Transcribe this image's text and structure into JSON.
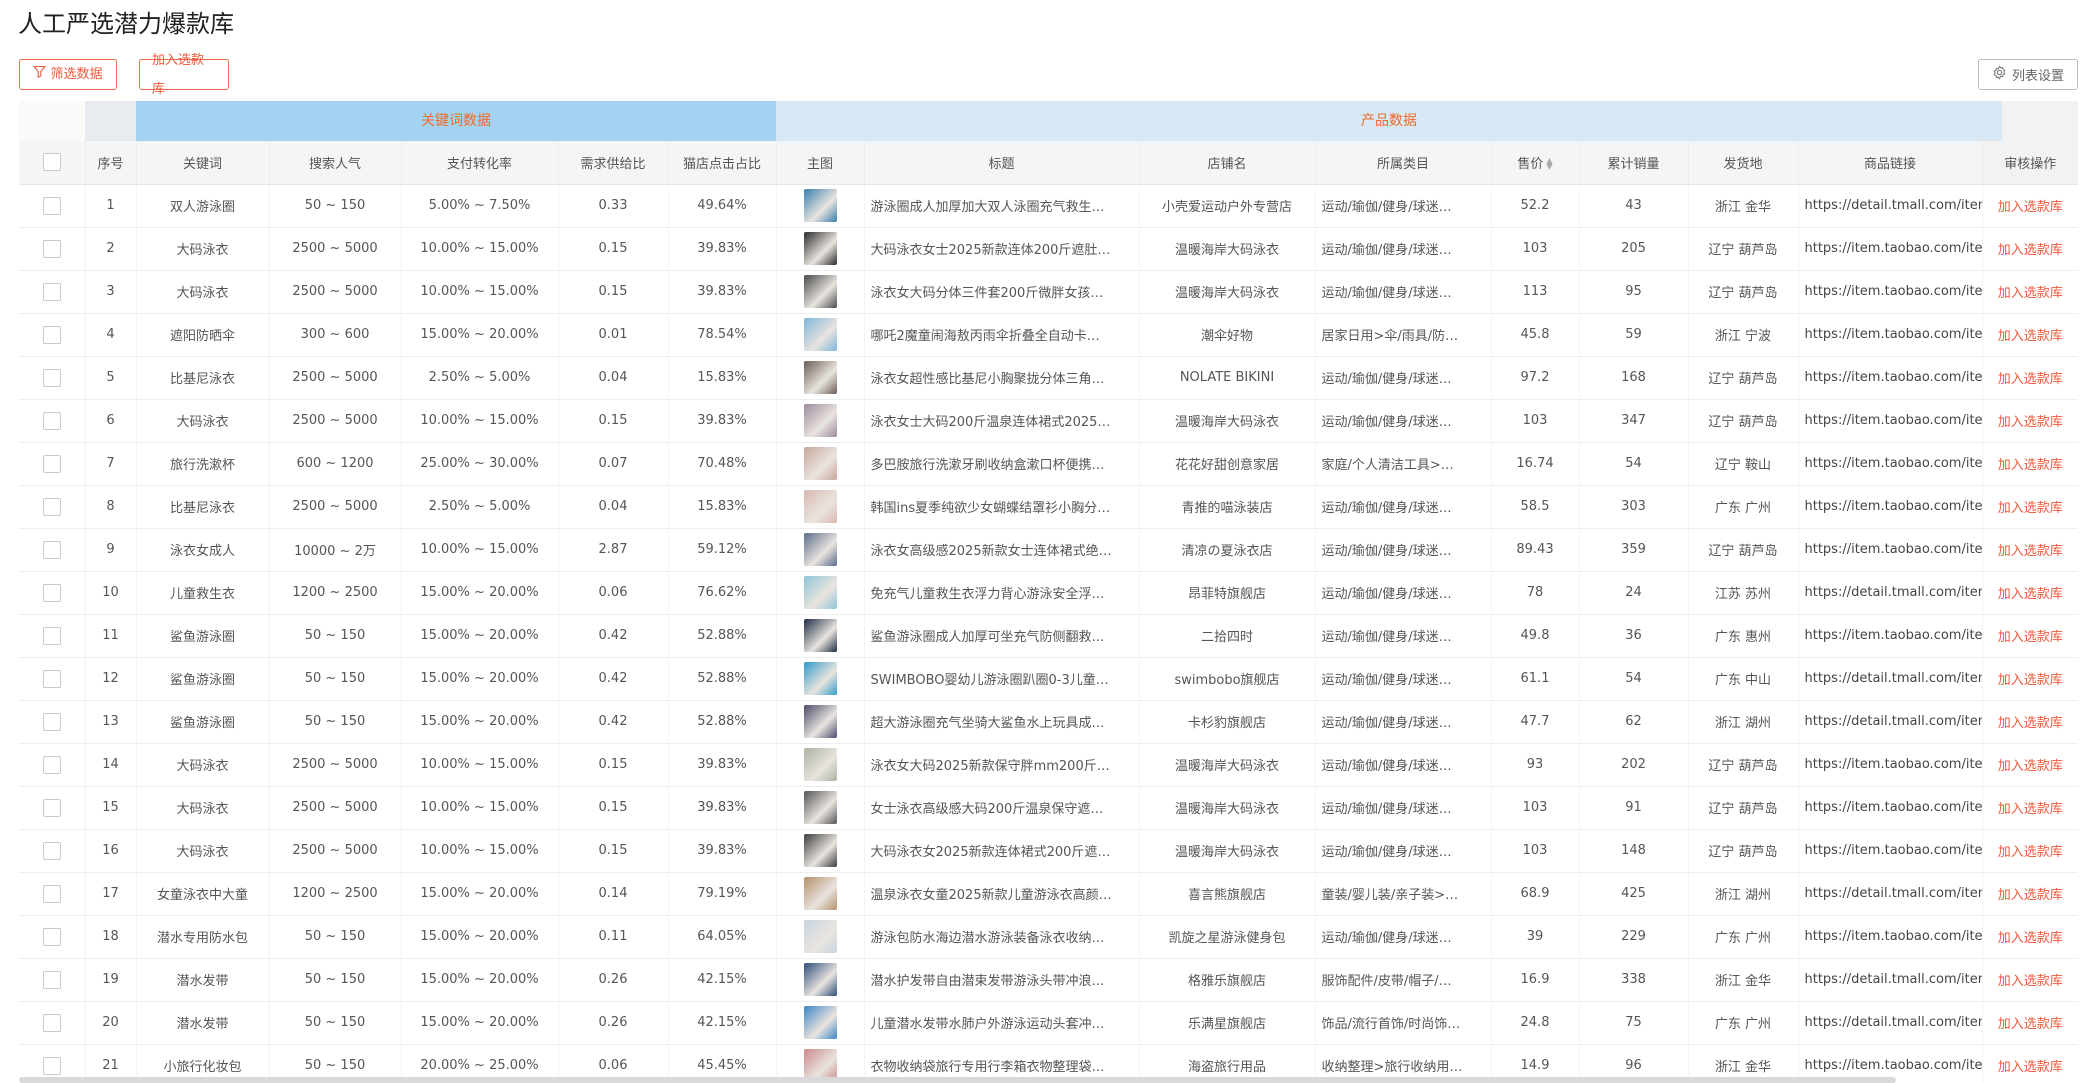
{
  "page": {
    "title": "人工严选潜力爆款库"
  },
  "toolbar": {
    "filter_label": "筛选数据",
    "add_label": "加入选款库",
    "columns_label": "列表设置"
  },
  "groups": {
    "keyword": "关键词数据",
    "product": "产品数据"
  },
  "columns": [
    "序号",
    "关键词",
    "搜索人气",
    "支付转化率",
    "需求供给比",
    "猫店点击占比",
    "主图",
    "标题",
    "店铺名",
    "所属类目",
    "售价",
    "累计销量",
    "发货地",
    "商品链接",
    "审核操作"
  ],
  "thumb_colors": [
    "#3a7fae",
    "#2a2a2a",
    "#4a4a4a",
    "#7cb6d9",
    "#6b5d55",
    "#9a8a9c",
    "#c7a69a",
    "#d9b8b0",
    "#5a6c8a",
    "#8fc4d8",
    "#1e2c44",
    "#2f9bc9",
    "#4a4a6a",
    "#a9b3a0",
    "#555555",
    "#3c3c3c",
    "#b5906a",
    "#c7d5e0",
    "#2b4d7a",
    "#3b84c4",
    "#c98a8a"
  ],
  "rows": [
    {
      "no": "1",
      "kw": "双人游泳圈",
      "pop": "50 ~ 150",
      "conv": "5.00% ~ 7.50%",
      "ratio": "0.33",
      "click": "49.64%",
      "title": "游泳圈成人加厚加大双人泳圈充气救生…",
      "shop": "小壳爱运动户外专营店",
      "cat": "运动/瑜伽/健身/球迷…",
      "price": "52.2",
      "sales": "43",
      "loc": "浙江 金华",
      "link": "https://detail.tmall.com/item.htm",
      "action": "加入选款库"
    },
    {
      "no": "2",
      "kw": "大码泳衣",
      "pop": "2500 ~ 5000",
      "conv": "10.00% ~ 15.00%",
      "ratio": "0.15",
      "click": "39.83%",
      "title": "大码泳衣女士2025新款连体200斤遮肚…",
      "shop": "温暖海岸大码泳衣",
      "cat": "运动/瑜伽/健身/球迷…",
      "price": "103",
      "sales": "205",
      "loc": "辽宁 葫芦岛",
      "link": "https://item.taobao.com/item.htm",
      "action": "加入选款库"
    },
    {
      "no": "3",
      "kw": "大码泳衣",
      "pop": "2500 ~ 5000",
      "conv": "10.00% ~ 15.00%",
      "ratio": "0.15",
      "click": "39.83%",
      "title": "泳衣女大码分体三件套200斤微胖女孩…",
      "shop": "温暖海岸大码泳衣",
      "cat": "运动/瑜伽/健身/球迷…",
      "price": "113",
      "sales": "95",
      "loc": "辽宁 葫芦岛",
      "link": "https://item.taobao.com/item.htm",
      "action": "加入选款库"
    },
    {
      "no": "4",
      "kw": "遮阳防晒伞",
      "pop": "300 ~ 600",
      "conv": "15.00% ~ 20.00%",
      "ratio": "0.01",
      "click": "78.54%",
      "title": "哪吒2魔童闹海敖丙雨伞折叠全自动卡…",
      "shop": "潮伞好物",
      "cat": "居家日用>伞/雨具/防…",
      "price": "45.8",
      "sales": "59",
      "loc": "浙江 宁波",
      "link": "https://item.taobao.com/item.htm",
      "action": "加入选款库"
    },
    {
      "no": "5",
      "kw": "比基尼泳衣",
      "pop": "2500 ~ 5000",
      "conv": "2.50% ~ 5.00%",
      "ratio": "0.04",
      "click": "15.83%",
      "title": "泳衣女超性感比基尼小胸聚拢分体三角…",
      "shop": "NOLATE BIKINI",
      "cat": "运动/瑜伽/健身/球迷…",
      "price": "97.2",
      "sales": "168",
      "loc": "辽宁 葫芦岛",
      "link": "https://item.taobao.com/item.htm",
      "action": "加入选款库"
    },
    {
      "no": "6",
      "kw": "大码泳衣",
      "pop": "2500 ~ 5000",
      "conv": "10.00% ~ 15.00%",
      "ratio": "0.15",
      "click": "39.83%",
      "title": "泳衣女士大码200斤温泉连体裙式2025…",
      "shop": "温暖海岸大码泳衣",
      "cat": "运动/瑜伽/健身/球迷…",
      "price": "103",
      "sales": "347",
      "loc": "辽宁 葫芦岛",
      "link": "https://item.taobao.com/item.htm",
      "action": "加入选款库"
    },
    {
      "no": "7",
      "kw": "旅行洗漱杯",
      "pop": "600 ~ 1200",
      "conv": "25.00% ~ 30.00%",
      "ratio": "0.07",
      "click": "70.48%",
      "title": "多巴胺旅行洗漱牙刷收纳盒漱口杯便携…",
      "shop": "花花好甜创意家居",
      "cat": "家庭/个人清洁工具>…",
      "price": "16.74",
      "sales": "54",
      "loc": "辽宁 鞍山",
      "link": "https://item.taobao.com/item.htm",
      "action": "加入选款库"
    },
    {
      "no": "8",
      "kw": "比基尼泳衣",
      "pop": "2500 ~ 5000",
      "conv": "2.50% ~ 5.00%",
      "ratio": "0.04",
      "click": "15.83%",
      "title": "韩国ins夏季纯欲少女蝴蝶结罩衫小胸分…",
      "shop": "青推的喵泳装店",
      "cat": "运动/瑜伽/健身/球迷…",
      "price": "58.5",
      "sales": "303",
      "loc": "广东 广州",
      "link": "https://item.taobao.com/item.htm",
      "action": "加入选款库"
    },
    {
      "no": "9",
      "kw": "泳衣女成人",
      "pop": "10000 ~ 2万",
      "conv": "10.00% ~ 15.00%",
      "ratio": "2.87",
      "click": "59.12%",
      "title": "泳衣女高级感2025新款女士连体裙式绝…",
      "shop": "清凉の夏泳衣店",
      "cat": "运动/瑜伽/健身/球迷…",
      "price": "89.43",
      "sales": "359",
      "loc": "辽宁 葫芦岛",
      "link": "https://item.taobao.com/item.htm",
      "action": "加入选款库"
    },
    {
      "no": "10",
      "kw": "儿童救生衣",
      "pop": "1200 ~ 2500",
      "conv": "15.00% ~ 20.00%",
      "ratio": "0.06",
      "click": "76.62%",
      "title": "免充气儿童救生衣浮力背心游泳安全浮…",
      "shop": "昂菲特旗舰店",
      "cat": "运动/瑜伽/健身/球迷…",
      "price": "78",
      "sales": "24",
      "loc": "江苏 苏州",
      "link": "https://detail.tmall.com/item.htm",
      "action": "加入选款库"
    },
    {
      "no": "11",
      "kw": "鲨鱼游泳圈",
      "pop": "50 ~ 150",
      "conv": "15.00% ~ 20.00%",
      "ratio": "0.42",
      "click": "52.88%",
      "title": "鲨鱼游泳圈成人加厚可坐充气防侧翻救…",
      "shop": "二拾四时",
      "cat": "运动/瑜伽/健身/球迷…",
      "price": "49.8",
      "sales": "36",
      "loc": "广东 惠州",
      "link": "https://item.taobao.com/item.htm",
      "action": "加入选款库"
    },
    {
      "no": "12",
      "kw": "鲨鱼游泳圈",
      "pop": "50 ~ 150",
      "conv": "15.00% ~ 20.00%",
      "ratio": "0.42",
      "click": "52.88%",
      "title": "SWIMBOBO婴幼儿游泳圈趴圈0-3儿童…",
      "shop": "swimbobo旗舰店",
      "cat": "运动/瑜伽/健身/球迷…",
      "price": "61.1",
      "sales": "54",
      "loc": "广东 中山",
      "link": "https://detail.tmall.com/item.htm",
      "action": "加入选款库"
    },
    {
      "no": "13",
      "kw": "鲨鱼游泳圈",
      "pop": "50 ~ 150",
      "conv": "15.00% ~ 20.00%",
      "ratio": "0.42",
      "click": "52.88%",
      "title": "超大游泳圈充气坐骑大鲨鱼水上玩具成…",
      "shop": "卡杉豹旗舰店",
      "cat": "运动/瑜伽/健身/球迷…",
      "price": "47.7",
      "sales": "62",
      "loc": "浙江 湖州",
      "link": "https://detail.tmall.com/item.htm",
      "action": "加入选款库"
    },
    {
      "no": "14",
      "kw": "大码泳衣",
      "pop": "2500 ~ 5000",
      "conv": "10.00% ~ 15.00%",
      "ratio": "0.15",
      "click": "39.83%",
      "title": "泳衣女大码2025新款保守胖mm200斤…",
      "shop": "温暖海岸大码泳衣",
      "cat": "运动/瑜伽/健身/球迷…",
      "price": "93",
      "sales": "202",
      "loc": "辽宁 葫芦岛",
      "link": "https://item.taobao.com/item.htm",
      "action": "加入选款库"
    },
    {
      "no": "15",
      "kw": "大码泳衣",
      "pop": "2500 ~ 5000",
      "conv": "10.00% ~ 15.00%",
      "ratio": "0.15",
      "click": "39.83%",
      "title": "女士泳衣高级感大码200斤温泉保守遮…",
      "shop": "温暖海岸大码泳衣",
      "cat": "运动/瑜伽/健身/球迷…",
      "price": "103",
      "sales": "91",
      "loc": "辽宁 葫芦岛",
      "link": "https://item.taobao.com/item.htm",
      "action": "加入选款库"
    },
    {
      "no": "16",
      "kw": "大码泳衣",
      "pop": "2500 ~ 5000",
      "conv": "10.00% ~ 15.00%",
      "ratio": "0.15",
      "click": "39.83%",
      "title": "大码泳衣女2025新款连体裙式200斤遮…",
      "shop": "温暖海岸大码泳衣",
      "cat": "运动/瑜伽/健身/球迷…",
      "price": "103",
      "sales": "148",
      "loc": "辽宁 葫芦岛",
      "link": "https://item.taobao.com/item.htm",
      "action": "加入选款库"
    },
    {
      "no": "17",
      "kw": "女童泳衣中大童",
      "pop": "1200 ~ 2500",
      "conv": "15.00% ~ 20.00%",
      "ratio": "0.14",
      "click": "79.19%",
      "title": "温泉泳衣女童2025新款儿童游泳衣高颜…",
      "shop": "喜言熊旗舰店",
      "cat": "童装/婴儿装/亲子装>…",
      "price": "68.9",
      "sales": "425",
      "loc": "浙江 湖州",
      "link": "https://detail.tmall.com/item.htm",
      "action": "加入选款库"
    },
    {
      "no": "18",
      "kw": "潜水专用防水包",
      "pop": "50 ~ 150",
      "conv": "15.00% ~ 20.00%",
      "ratio": "0.11",
      "click": "64.05%",
      "title": "游泳包防水海边潜水游泳装备泳衣收纳…",
      "shop": "凯旋之星游泳健身包",
      "cat": "运动/瑜伽/健身/球迷…",
      "price": "39",
      "sales": "229",
      "loc": "广东 广州",
      "link": "https://item.taobao.com/item.htm",
      "action": "加入选款库"
    },
    {
      "no": "19",
      "kw": "潜水发带",
      "pop": "50 ~ 150",
      "conv": "15.00% ~ 20.00%",
      "ratio": "0.26",
      "click": "42.15%",
      "title": "潜水护发带自由潜束发带游泳头带冲浪…",
      "shop": "格雅乐旗舰店",
      "cat": "服饰配件/皮带/帽子/…",
      "price": "16.9",
      "sales": "338",
      "loc": "浙江 金华",
      "link": "https://detail.tmall.com/item.htm",
      "action": "加入选款库"
    },
    {
      "no": "20",
      "kw": "潜水发带",
      "pop": "50 ~ 150",
      "conv": "15.00% ~ 20.00%",
      "ratio": "0.26",
      "click": "42.15%",
      "title": "儿童潜水发带水肺户外游泳运动头套冲…",
      "shop": "乐满星旗舰店",
      "cat": "饰品/流行首饰/时尚饰…",
      "price": "24.8",
      "sales": "75",
      "loc": "广东 广州",
      "link": "https://detail.tmall.com/item.htm",
      "action": "加入选款库"
    },
    {
      "no": "21",
      "kw": "小旅行化妆包",
      "pop": "50 ~ 150",
      "conv": "20.00% ~ 25.00%",
      "ratio": "0.06",
      "click": "45.45%",
      "title": "衣物收纳袋旅行专用行李箱衣物整理袋…",
      "shop": "海盗旅行用品",
      "cat": "收纳整理>旅行收纳用…",
      "price": "14.9",
      "sales": "96",
      "loc": "浙江 金华",
      "link": "https://item.taobao.com/item.htm",
      "action": "加入选款库"
    }
  ]
}
